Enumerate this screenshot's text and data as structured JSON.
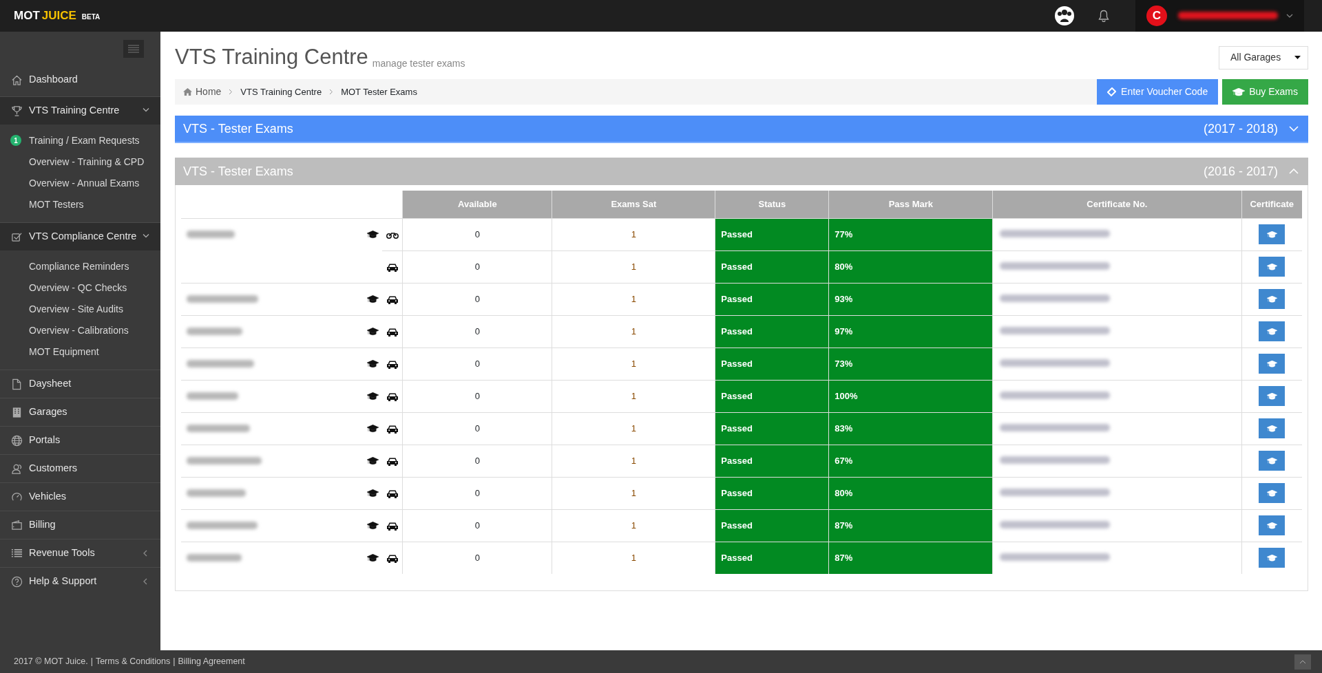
{
  "brand": {
    "first": "MOT",
    "second": "JUICE",
    "tag": "BETA"
  },
  "user": {
    "avatar_letter": "C",
    "name_redacted": true
  },
  "sidebar": {
    "items": [
      {
        "kind": "link",
        "label": "Dashboard"
      },
      {
        "kind": "section",
        "label": "VTS Training Centre",
        "expanded": true,
        "children": [
          {
            "label": "Training / Exam Requests",
            "badge": "1"
          },
          {
            "label": "Overview - Training & CPD"
          },
          {
            "label": "Overview - Annual Exams"
          },
          {
            "label": "MOT Testers"
          }
        ]
      },
      {
        "kind": "section",
        "label": "VTS Compliance Centre",
        "expanded": true,
        "children": [
          {
            "label": "Compliance Reminders"
          },
          {
            "label": "Overview - QC Checks"
          },
          {
            "label": "Overview - Site Audits"
          },
          {
            "label": "Overview - Calibrations"
          },
          {
            "label": "MOT Equipment"
          }
        ]
      },
      {
        "kind": "link",
        "label": "Daysheet"
      },
      {
        "kind": "link",
        "label": "Garages"
      },
      {
        "kind": "link",
        "label": "Portals"
      },
      {
        "kind": "link",
        "label": "Customers"
      },
      {
        "kind": "link",
        "label": "Vehicles"
      },
      {
        "kind": "link",
        "label": "Billing"
      },
      {
        "kind": "section",
        "label": "Revenue Tools",
        "expanded": false
      },
      {
        "kind": "section",
        "label": "Help & Support",
        "expanded": false
      }
    ]
  },
  "page": {
    "title": "VTS Training Centre",
    "subtitle": "manage tester exams",
    "garage_select": "All Garages",
    "breadcrumb": [
      "Home",
      "VTS Training Centre",
      "MOT Tester Exams"
    ],
    "buttons": [
      {
        "kind": "voucher",
        "label": "Enter Voucher Code"
      },
      {
        "kind": "buy",
        "label": "Buy Exams"
      }
    ]
  },
  "panels": [
    {
      "title": "VTS - Tester Exams",
      "period": "(2017 - 2018)",
      "current": true,
      "expanded": false
    },
    {
      "title": "VTS - Tester Exams",
      "period": "(2016 - 2017)",
      "current": false,
      "expanded": true
    }
  ],
  "table": {
    "columns": [
      "Available",
      "Exams Sat",
      "Status",
      "Pass Mark",
      "Certificate No.",
      "Certificate"
    ],
    "rows": [
      {
        "name_redacted": true,
        "kind": "motorcycle",
        "available": "0",
        "exams_sat": "1",
        "status": "Passed",
        "pass_mark": "77%"
      },
      {
        "name_redacted": false,
        "kind": "car",
        "available": "0",
        "exams_sat": "1",
        "status": "Passed",
        "pass_mark": "80%"
      },
      {
        "name_redacted": true,
        "kind": "car",
        "available": "0",
        "exams_sat": "1",
        "status": "Passed",
        "pass_mark": "93%"
      },
      {
        "name_redacted": true,
        "kind": "car",
        "available": "0",
        "exams_sat": "1",
        "status": "Passed",
        "pass_mark": "97%"
      },
      {
        "name_redacted": true,
        "kind": "car",
        "available": "0",
        "exams_sat": "1",
        "status": "Passed",
        "pass_mark": "73%"
      },
      {
        "name_redacted": true,
        "kind": "car",
        "available": "0",
        "exams_sat": "1",
        "status": "Passed",
        "pass_mark": "100%"
      },
      {
        "name_redacted": true,
        "kind": "car",
        "available": "0",
        "exams_sat": "1",
        "status": "Passed",
        "pass_mark": "83%"
      },
      {
        "name_redacted": true,
        "kind": "car",
        "available": "0",
        "exams_sat": "1",
        "status": "Passed",
        "pass_mark": "67%"
      },
      {
        "name_redacted": true,
        "kind": "car",
        "available": "0",
        "exams_sat": "1",
        "status": "Passed",
        "pass_mark": "80%"
      },
      {
        "name_redacted": true,
        "kind": "car",
        "available": "0",
        "exams_sat": "1",
        "status": "Passed",
        "pass_mark": "87%"
      },
      {
        "name_redacted": true,
        "kind": "car",
        "available": "0",
        "exams_sat": "1",
        "status": "Passed",
        "pass_mark": "87%"
      }
    ]
  },
  "footer": {
    "copyright": "2017 © MOT Juice.",
    "links": [
      "Terms & Conditions",
      "Billing Agreement"
    ],
    "separator": "|"
  }
}
